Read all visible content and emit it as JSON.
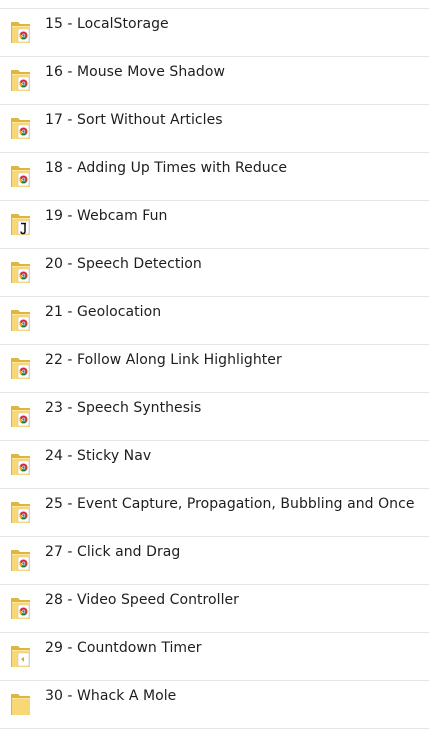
{
  "folders": [
    {
      "label": "15 - LocalStorage",
      "icon": "folder-chrome-icon"
    },
    {
      "label": "16 - Mouse Move Shadow",
      "icon": "folder-chrome-icon"
    },
    {
      "label": "17 - Sort Without Articles",
      "icon": "folder-chrome-icon"
    },
    {
      "label": "18 - Adding Up Times with Reduce",
      "icon": "folder-chrome-icon"
    },
    {
      "label": "19 - Webcam Fun",
      "icon": "folder-script-icon"
    },
    {
      "label": "20 - Speech Detection",
      "icon": "folder-chrome-icon"
    },
    {
      "label": "21 - Geolocation",
      "icon": "folder-chrome-icon"
    },
    {
      "label": "22 - Follow Along Link Highlighter",
      "icon": "folder-chrome-icon"
    },
    {
      "label": "23 - Speech Synthesis",
      "icon": "folder-chrome-icon"
    },
    {
      "label": "24 - Sticky Nav",
      "icon": "folder-chrome-icon"
    },
    {
      "label": "25 - Event Capture, Propagation, Bubbling and Once",
      "icon": "folder-chrome-icon"
    },
    {
      "label": "27 - Click and Drag",
      "icon": "folder-chrome-icon"
    },
    {
      "label": "28 - Video Speed Controller",
      "icon": "folder-chrome-icon"
    },
    {
      "label": "29 - Countdown Timer",
      "icon": "folder-document-icon"
    },
    {
      "label": "30 - Whack A Mole",
      "icon": "folder-icon"
    }
  ],
  "colors": {
    "folder_back": "#e0b440",
    "folder_front": "#f8d775",
    "divider": "#e5e5e5",
    "text": "#1e1e1e"
  }
}
